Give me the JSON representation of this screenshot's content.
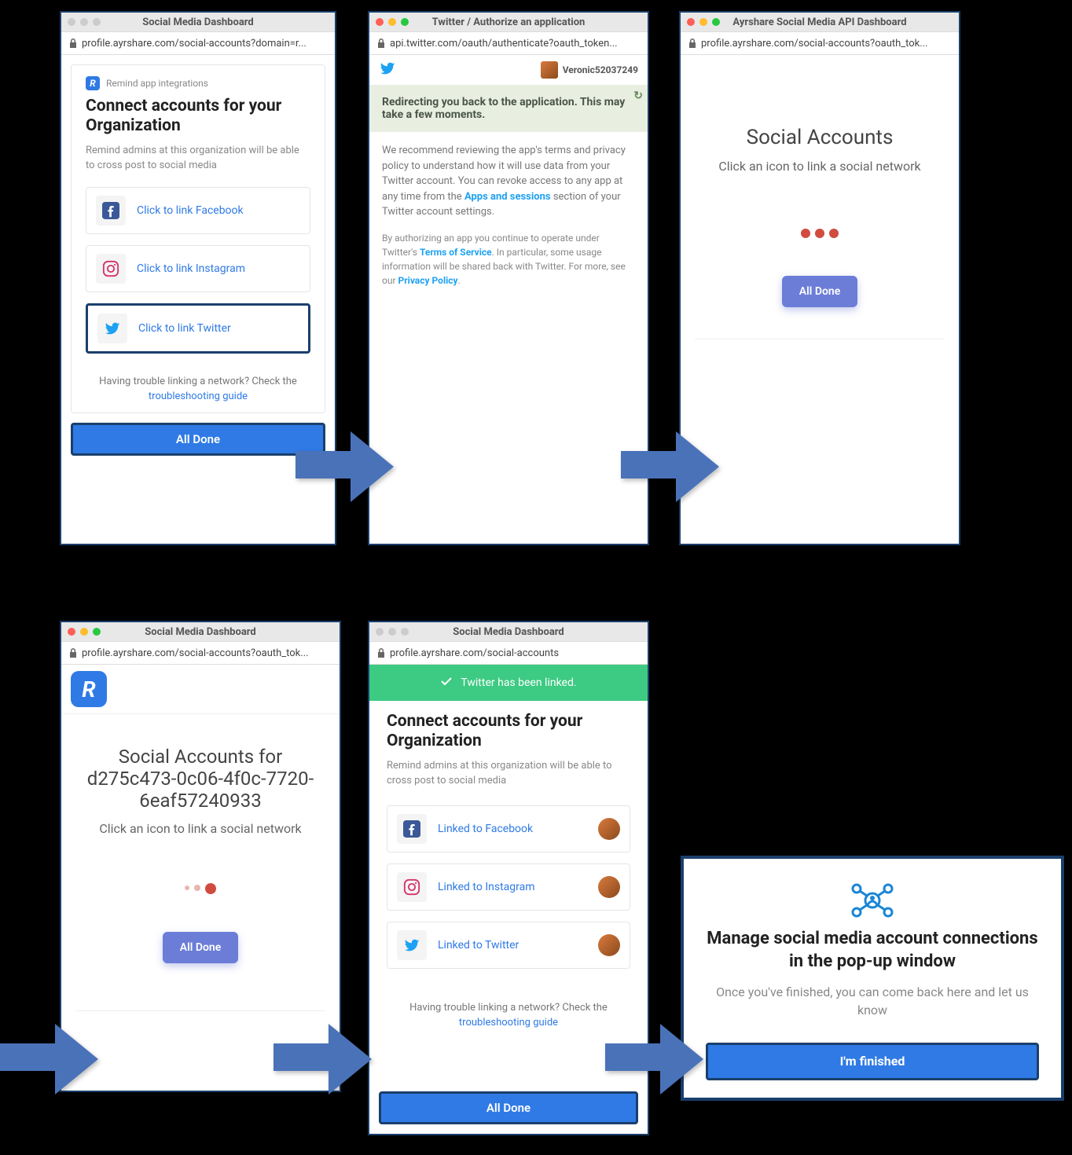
{
  "step1": {
    "title": "Social Media Dashboard",
    "url": "profile.ayrshare.com/social-accounts?domain=r...",
    "remind_label": "Remind app integrations",
    "heading": "Connect accounts for your Organization",
    "sub": "Remind admins at this organization will be able to cross post to social media",
    "fb": "Click to link Facebook",
    "ig": "Click to link Instagram",
    "tw": "Click to link Twitter",
    "trouble_pre": "Having trouble linking a network? Check the ",
    "trouble_link": "troubleshooting guide",
    "all_done": "All Done"
  },
  "step2": {
    "title": "Twitter / Authorize an application",
    "url": "api.twitter.com/oauth/authenticate?oauth_token...",
    "username": "Veronic52037249",
    "banner": "Redirecting you back to the application. This may take a few moments.",
    "info_pre": "We recommend reviewing the app's terms and privacy policy to understand how it will use data from your Twitter account. You can revoke access to any app at any time from the ",
    "apps_link": "Apps and sessions",
    "info_post": " section of your Twitter account settings.",
    "auth_pre": "By authorizing an app you continue to operate under Twitter's ",
    "tos": "Terms of Service",
    "auth_mid": ". In particular, some usage information will be shared back with Twitter. For more, see our ",
    "pp": "Privacy Policy",
    "auth_end": "."
  },
  "step3": {
    "title": "Ayrshare Social Media API Dashboard",
    "url": "profile.ayrshare.com/social-accounts?oauth_tok...",
    "heading": "Social Accounts",
    "sub": "Click an icon to link a social network",
    "all_done": "All Done"
  },
  "step4": {
    "title": "Social Media Dashboard",
    "url": "profile.ayrshare.com/social-accounts?oauth_tok...",
    "heading": "Social Accounts for d275c473-0c06-4f0c-7720-6eaf57240933",
    "sub": "Click an icon to link a social network",
    "all_done": "All Done"
  },
  "step5": {
    "title": "Social Media Dashboard",
    "url": "profile.ayrshare.com/social-accounts",
    "toast": "Twitter has been linked.",
    "heading": "Connect accounts for your Organization",
    "sub": "Remind admins at this organization will be able to cross post to social media",
    "fb": "Linked to Facebook",
    "ig": "Linked to Instagram",
    "tw": "Linked to Twitter",
    "trouble_pre": "Having trouble linking a network? Check the ",
    "trouble_link": "troubleshooting guide",
    "all_done": "All Done"
  },
  "step6": {
    "heading": "Manage social media account connections in the pop-up window",
    "sub": "Once you've finished, you can come back here and let us know",
    "button": "I'm finished"
  }
}
